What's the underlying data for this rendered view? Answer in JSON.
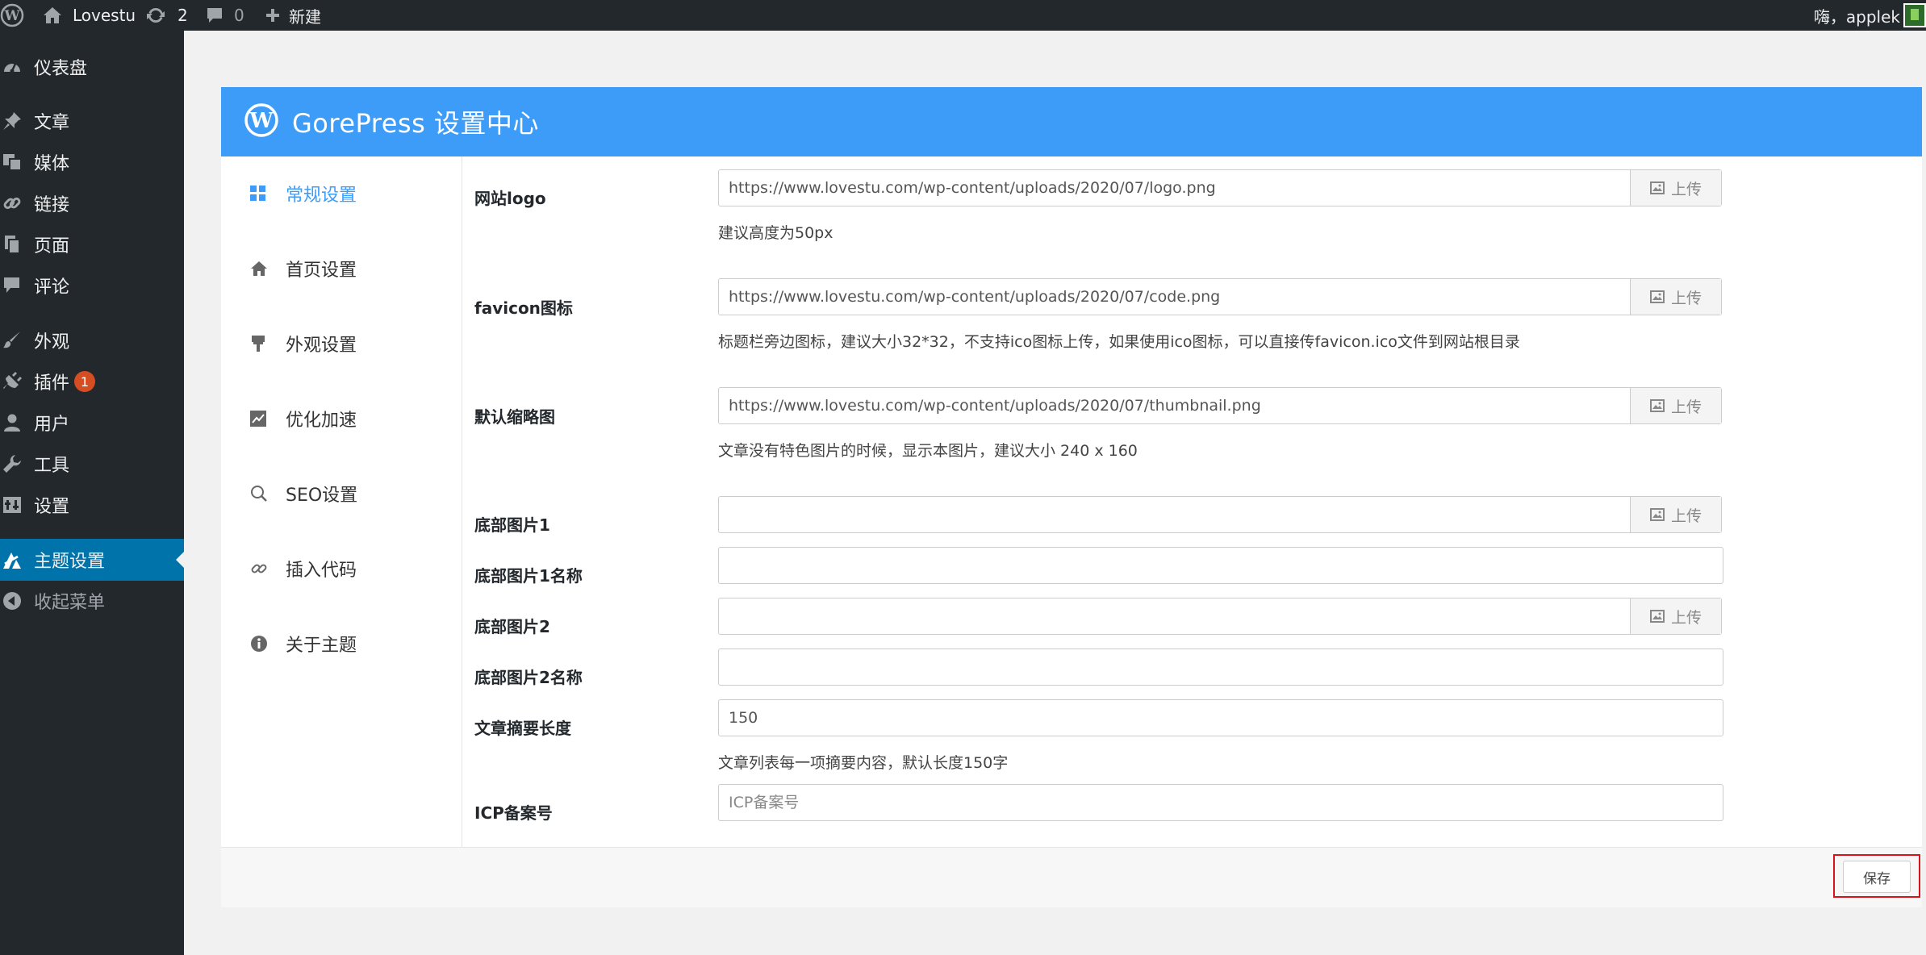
{
  "adminbar": {
    "site_name": "Lovestu",
    "updates_count": "2",
    "comments_count": "0",
    "new_label": "新建",
    "account_greeting": "嗨，applek"
  },
  "menu": {
    "items": [
      {
        "label": "仪表盘",
        "icon": "dashboard-icon"
      },
      {
        "label": "文章",
        "icon": "pin-icon"
      },
      {
        "label": "媒体",
        "icon": "media-icon"
      },
      {
        "label": "链接",
        "icon": "link-icon"
      },
      {
        "label": "页面",
        "icon": "page-icon"
      },
      {
        "label": "评论",
        "icon": "comment-icon"
      },
      {
        "label": "外观",
        "icon": "brush-icon"
      },
      {
        "label": "插件",
        "icon": "plugin-icon",
        "badge": "1"
      },
      {
        "label": "用户",
        "icon": "user-icon"
      },
      {
        "label": "工具",
        "icon": "wrench-icon"
      },
      {
        "label": "设置",
        "icon": "settings-icon"
      },
      {
        "label": "主题设置",
        "icon": "theme-settings-icon",
        "current": true
      },
      {
        "label": "收起菜单",
        "icon": "collapse-icon"
      }
    ]
  },
  "panel": {
    "title": "GorePress 设置中心",
    "nav": [
      {
        "label": "常规设置",
        "icon": "grid-icon",
        "active": true
      },
      {
        "label": "首页设置",
        "icon": "home-icon"
      },
      {
        "label": "外观设置",
        "icon": "paint-icon"
      },
      {
        "label": "优化加速",
        "icon": "chart-icon"
      },
      {
        "label": "SEO设置",
        "icon": "search-icon"
      },
      {
        "label": "插入代码",
        "icon": "link-icon"
      },
      {
        "label": "关于主题",
        "icon": "info-icon"
      }
    ],
    "upload_label": "上传",
    "fields": {
      "logo": {
        "label": "网站logo",
        "value": "https://www.lovestu.com/wp-content/uploads/2020/07/logo.png",
        "desc": "建议高度为50px"
      },
      "favicon": {
        "label": "favicon图标",
        "value": "https://www.lovestu.com/wp-content/uploads/2020/07/code.png",
        "desc": "标题栏旁边图标，建议大小32*32，不支持ico图标上传，如果使用ico图标，可以直接传favicon.ico文件到网站根目录"
      },
      "thumbnail": {
        "label": "默认缩略图",
        "value": "https://www.lovestu.com/wp-content/uploads/2020/07/thumbnail.png",
        "desc": "文章没有特色图片的时候，显示本图片，建议大小 240 x 160"
      },
      "footer_img1": {
        "label": "底部图片1",
        "value": ""
      },
      "footer_img1_name": {
        "label": "底部图片1名称",
        "value": ""
      },
      "footer_img2": {
        "label": "底部图片2",
        "value": ""
      },
      "footer_img2_name": {
        "label": "底部图片2名称",
        "value": ""
      },
      "excerpt_length": {
        "label": "文章摘要长度",
        "value": "150",
        "desc": "文章列表每一项摘要内容，默认长度150字"
      },
      "icp": {
        "label": "ICP备案号",
        "value": "",
        "placeholder": "ICP备案号"
      }
    },
    "save_label": "保存"
  },
  "colors": {
    "adminbar_bg": "#23282d",
    "menu_current": "#0073aa",
    "panel_header": "#3d9cf8",
    "badge": "#d54e21",
    "highlight_border": "#d9121b"
  }
}
